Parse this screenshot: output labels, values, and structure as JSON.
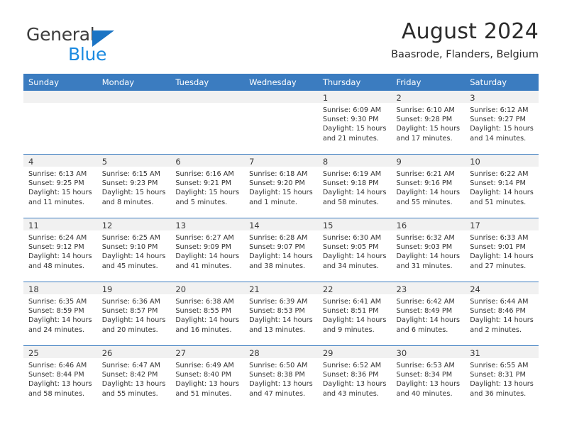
{
  "brand": {
    "name_part1": "General",
    "name_part2": "Blue",
    "logo_icon": "triangle-logo-icon"
  },
  "header": {
    "title": "August 2024",
    "subtitle": "Baasrode, Flanders, Belgium"
  },
  "calendar": {
    "weekday_headers": [
      "Sunday",
      "Monday",
      "Tuesday",
      "Wednesday",
      "Thursday",
      "Friday",
      "Saturday"
    ],
    "accent_color": "#3b7cc0",
    "daynum_band_color": "#f1f1f1",
    "weeks": [
      [
        {
          "empty": true
        },
        {
          "empty": true
        },
        {
          "empty": true
        },
        {
          "empty": true
        },
        {
          "day": "1",
          "sunrise": "Sunrise: 6:09 AM",
          "sunset": "Sunset: 9:30 PM",
          "daylight1": "Daylight: 15 hours",
          "daylight2": "and 21 minutes."
        },
        {
          "day": "2",
          "sunrise": "Sunrise: 6:10 AM",
          "sunset": "Sunset: 9:28 PM",
          "daylight1": "Daylight: 15 hours",
          "daylight2": "and 17 minutes."
        },
        {
          "day": "3",
          "sunrise": "Sunrise: 6:12 AM",
          "sunset": "Sunset: 9:27 PM",
          "daylight1": "Daylight: 15 hours",
          "daylight2": "and 14 minutes."
        }
      ],
      [
        {
          "day": "4",
          "sunrise": "Sunrise: 6:13 AM",
          "sunset": "Sunset: 9:25 PM",
          "daylight1": "Daylight: 15 hours",
          "daylight2": "and 11 minutes."
        },
        {
          "day": "5",
          "sunrise": "Sunrise: 6:15 AM",
          "sunset": "Sunset: 9:23 PM",
          "daylight1": "Daylight: 15 hours",
          "daylight2": "and 8 minutes."
        },
        {
          "day": "6",
          "sunrise": "Sunrise: 6:16 AM",
          "sunset": "Sunset: 9:21 PM",
          "daylight1": "Daylight: 15 hours",
          "daylight2": "and 5 minutes."
        },
        {
          "day": "7",
          "sunrise": "Sunrise: 6:18 AM",
          "sunset": "Sunset: 9:20 PM",
          "daylight1": "Daylight: 15 hours",
          "daylight2": "and 1 minute."
        },
        {
          "day": "8",
          "sunrise": "Sunrise: 6:19 AM",
          "sunset": "Sunset: 9:18 PM",
          "daylight1": "Daylight: 14 hours",
          "daylight2": "and 58 minutes."
        },
        {
          "day": "9",
          "sunrise": "Sunrise: 6:21 AM",
          "sunset": "Sunset: 9:16 PM",
          "daylight1": "Daylight: 14 hours",
          "daylight2": "and 55 minutes."
        },
        {
          "day": "10",
          "sunrise": "Sunrise: 6:22 AM",
          "sunset": "Sunset: 9:14 PM",
          "daylight1": "Daylight: 14 hours",
          "daylight2": "and 51 minutes."
        }
      ],
      [
        {
          "day": "11",
          "sunrise": "Sunrise: 6:24 AM",
          "sunset": "Sunset: 9:12 PM",
          "daylight1": "Daylight: 14 hours",
          "daylight2": "and 48 minutes."
        },
        {
          "day": "12",
          "sunrise": "Sunrise: 6:25 AM",
          "sunset": "Sunset: 9:10 PM",
          "daylight1": "Daylight: 14 hours",
          "daylight2": "and 45 minutes."
        },
        {
          "day": "13",
          "sunrise": "Sunrise: 6:27 AM",
          "sunset": "Sunset: 9:09 PM",
          "daylight1": "Daylight: 14 hours",
          "daylight2": "and 41 minutes."
        },
        {
          "day": "14",
          "sunrise": "Sunrise: 6:28 AM",
          "sunset": "Sunset: 9:07 PM",
          "daylight1": "Daylight: 14 hours",
          "daylight2": "and 38 minutes."
        },
        {
          "day": "15",
          "sunrise": "Sunrise: 6:30 AM",
          "sunset": "Sunset: 9:05 PM",
          "daylight1": "Daylight: 14 hours",
          "daylight2": "and 34 minutes."
        },
        {
          "day": "16",
          "sunrise": "Sunrise: 6:32 AM",
          "sunset": "Sunset: 9:03 PM",
          "daylight1": "Daylight: 14 hours",
          "daylight2": "and 31 minutes."
        },
        {
          "day": "17",
          "sunrise": "Sunrise: 6:33 AM",
          "sunset": "Sunset: 9:01 PM",
          "daylight1": "Daylight: 14 hours",
          "daylight2": "and 27 minutes."
        }
      ],
      [
        {
          "day": "18",
          "sunrise": "Sunrise: 6:35 AM",
          "sunset": "Sunset: 8:59 PM",
          "daylight1": "Daylight: 14 hours",
          "daylight2": "and 24 minutes."
        },
        {
          "day": "19",
          "sunrise": "Sunrise: 6:36 AM",
          "sunset": "Sunset: 8:57 PM",
          "daylight1": "Daylight: 14 hours",
          "daylight2": "and 20 minutes."
        },
        {
          "day": "20",
          "sunrise": "Sunrise: 6:38 AM",
          "sunset": "Sunset: 8:55 PM",
          "daylight1": "Daylight: 14 hours",
          "daylight2": "and 16 minutes."
        },
        {
          "day": "21",
          "sunrise": "Sunrise: 6:39 AM",
          "sunset": "Sunset: 8:53 PM",
          "daylight1": "Daylight: 14 hours",
          "daylight2": "and 13 minutes."
        },
        {
          "day": "22",
          "sunrise": "Sunrise: 6:41 AM",
          "sunset": "Sunset: 8:51 PM",
          "daylight1": "Daylight: 14 hours",
          "daylight2": "and 9 minutes."
        },
        {
          "day": "23",
          "sunrise": "Sunrise: 6:42 AM",
          "sunset": "Sunset: 8:49 PM",
          "daylight1": "Daylight: 14 hours",
          "daylight2": "and 6 minutes."
        },
        {
          "day": "24",
          "sunrise": "Sunrise: 6:44 AM",
          "sunset": "Sunset: 8:46 PM",
          "daylight1": "Daylight: 14 hours",
          "daylight2": "and 2 minutes."
        }
      ],
      [
        {
          "day": "25",
          "sunrise": "Sunrise: 6:46 AM",
          "sunset": "Sunset: 8:44 PM",
          "daylight1": "Daylight: 13 hours",
          "daylight2": "and 58 minutes."
        },
        {
          "day": "26",
          "sunrise": "Sunrise: 6:47 AM",
          "sunset": "Sunset: 8:42 PM",
          "daylight1": "Daylight: 13 hours",
          "daylight2": "and 55 minutes."
        },
        {
          "day": "27",
          "sunrise": "Sunrise: 6:49 AM",
          "sunset": "Sunset: 8:40 PM",
          "daylight1": "Daylight: 13 hours",
          "daylight2": "and 51 minutes."
        },
        {
          "day": "28",
          "sunrise": "Sunrise: 6:50 AM",
          "sunset": "Sunset: 8:38 PM",
          "daylight1": "Daylight: 13 hours",
          "daylight2": "and 47 minutes."
        },
        {
          "day": "29",
          "sunrise": "Sunrise: 6:52 AM",
          "sunset": "Sunset: 8:36 PM",
          "daylight1": "Daylight: 13 hours",
          "daylight2": "and 43 minutes."
        },
        {
          "day": "30",
          "sunrise": "Sunrise: 6:53 AM",
          "sunset": "Sunset: 8:34 PM",
          "daylight1": "Daylight: 13 hours",
          "daylight2": "and 40 minutes."
        },
        {
          "day": "31",
          "sunrise": "Sunrise: 6:55 AM",
          "sunset": "Sunset: 8:31 PM",
          "daylight1": "Daylight: 13 hours",
          "daylight2": "and 36 minutes."
        }
      ]
    ]
  }
}
